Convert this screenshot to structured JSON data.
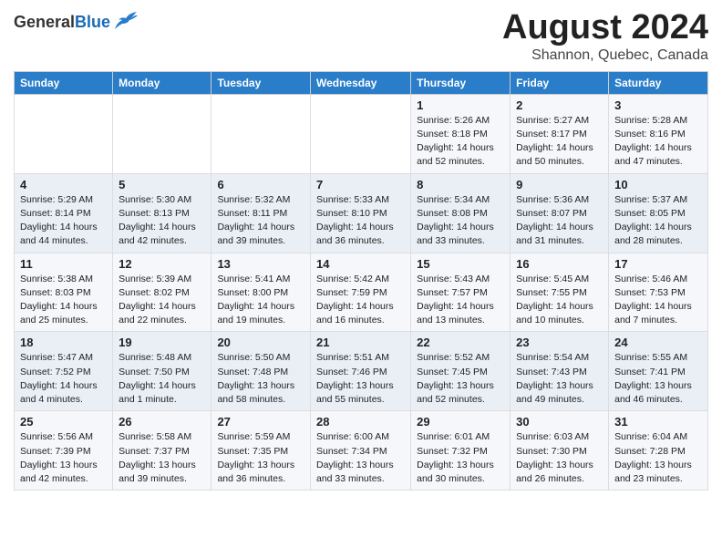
{
  "header": {
    "logo_general": "General",
    "logo_blue": "Blue",
    "month_title": "August 2024",
    "subtitle": "Shannon, Quebec, Canada"
  },
  "weekdays": [
    "Sunday",
    "Monday",
    "Tuesday",
    "Wednesday",
    "Thursday",
    "Friday",
    "Saturday"
  ],
  "weeks": [
    [
      {
        "day": "",
        "info": ""
      },
      {
        "day": "",
        "info": ""
      },
      {
        "day": "",
        "info": ""
      },
      {
        "day": "",
        "info": ""
      },
      {
        "day": "1",
        "info": "Sunrise: 5:26 AM\nSunset: 8:18 PM\nDaylight: 14 hours\nand 52 minutes."
      },
      {
        "day": "2",
        "info": "Sunrise: 5:27 AM\nSunset: 8:17 PM\nDaylight: 14 hours\nand 50 minutes."
      },
      {
        "day": "3",
        "info": "Sunrise: 5:28 AM\nSunset: 8:16 PM\nDaylight: 14 hours\nand 47 minutes."
      }
    ],
    [
      {
        "day": "4",
        "info": "Sunrise: 5:29 AM\nSunset: 8:14 PM\nDaylight: 14 hours\nand 44 minutes."
      },
      {
        "day": "5",
        "info": "Sunrise: 5:30 AM\nSunset: 8:13 PM\nDaylight: 14 hours\nand 42 minutes."
      },
      {
        "day": "6",
        "info": "Sunrise: 5:32 AM\nSunset: 8:11 PM\nDaylight: 14 hours\nand 39 minutes."
      },
      {
        "day": "7",
        "info": "Sunrise: 5:33 AM\nSunset: 8:10 PM\nDaylight: 14 hours\nand 36 minutes."
      },
      {
        "day": "8",
        "info": "Sunrise: 5:34 AM\nSunset: 8:08 PM\nDaylight: 14 hours\nand 33 minutes."
      },
      {
        "day": "9",
        "info": "Sunrise: 5:36 AM\nSunset: 8:07 PM\nDaylight: 14 hours\nand 31 minutes."
      },
      {
        "day": "10",
        "info": "Sunrise: 5:37 AM\nSunset: 8:05 PM\nDaylight: 14 hours\nand 28 minutes."
      }
    ],
    [
      {
        "day": "11",
        "info": "Sunrise: 5:38 AM\nSunset: 8:03 PM\nDaylight: 14 hours\nand 25 minutes."
      },
      {
        "day": "12",
        "info": "Sunrise: 5:39 AM\nSunset: 8:02 PM\nDaylight: 14 hours\nand 22 minutes."
      },
      {
        "day": "13",
        "info": "Sunrise: 5:41 AM\nSunset: 8:00 PM\nDaylight: 14 hours\nand 19 minutes."
      },
      {
        "day": "14",
        "info": "Sunrise: 5:42 AM\nSunset: 7:59 PM\nDaylight: 14 hours\nand 16 minutes."
      },
      {
        "day": "15",
        "info": "Sunrise: 5:43 AM\nSunset: 7:57 PM\nDaylight: 14 hours\nand 13 minutes."
      },
      {
        "day": "16",
        "info": "Sunrise: 5:45 AM\nSunset: 7:55 PM\nDaylight: 14 hours\nand 10 minutes."
      },
      {
        "day": "17",
        "info": "Sunrise: 5:46 AM\nSunset: 7:53 PM\nDaylight: 14 hours\nand 7 minutes."
      }
    ],
    [
      {
        "day": "18",
        "info": "Sunrise: 5:47 AM\nSunset: 7:52 PM\nDaylight: 14 hours\nand 4 minutes."
      },
      {
        "day": "19",
        "info": "Sunrise: 5:48 AM\nSunset: 7:50 PM\nDaylight: 14 hours\nand 1 minute."
      },
      {
        "day": "20",
        "info": "Sunrise: 5:50 AM\nSunset: 7:48 PM\nDaylight: 13 hours\nand 58 minutes."
      },
      {
        "day": "21",
        "info": "Sunrise: 5:51 AM\nSunset: 7:46 PM\nDaylight: 13 hours\nand 55 minutes."
      },
      {
        "day": "22",
        "info": "Sunrise: 5:52 AM\nSunset: 7:45 PM\nDaylight: 13 hours\nand 52 minutes."
      },
      {
        "day": "23",
        "info": "Sunrise: 5:54 AM\nSunset: 7:43 PM\nDaylight: 13 hours\nand 49 minutes."
      },
      {
        "day": "24",
        "info": "Sunrise: 5:55 AM\nSunset: 7:41 PM\nDaylight: 13 hours\nand 46 minutes."
      }
    ],
    [
      {
        "day": "25",
        "info": "Sunrise: 5:56 AM\nSunset: 7:39 PM\nDaylight: 13 hours\nand 42 minutes."
      },
      {
        "day": "26",
        "info": "Sunrise: 5:58 AM\nSunset: 7:37 PM\nDaylight: 13 hours\nand 39 minutes."
      },
      {
        "day": "27",
        "info": "Sunrise: 5:59 AM\nSunset: 7:35 PM\nDaylight: 13 hours\nand 36 minutes."
      },
      {
        "day": "28",
        "info": "Sunrise: 6:00 AM\nSunset: 7:34 PM\nDaylight: 13 hours\nand 33 minutes."
      },
      {
        "day": "29",
        "info": "Sunrise: 6:01 AM\nSunset: 7:32 PM\nDaylight: 13 hours\nand 30 minutes."
      },
      {
        "day": "30",
        "info": "Sunrise: 6:03 AM\nSunset: 7:30 PM\nDaylight: 13 hours\nand 26 minutes."
      },
      {
        "day": "31",
        "info": "Sunrise: 6:04 AM\nSunset: 7:28 PM\nDaylight: 13 hours\nand 23 minutes."
      }
    ]
  ]
}
